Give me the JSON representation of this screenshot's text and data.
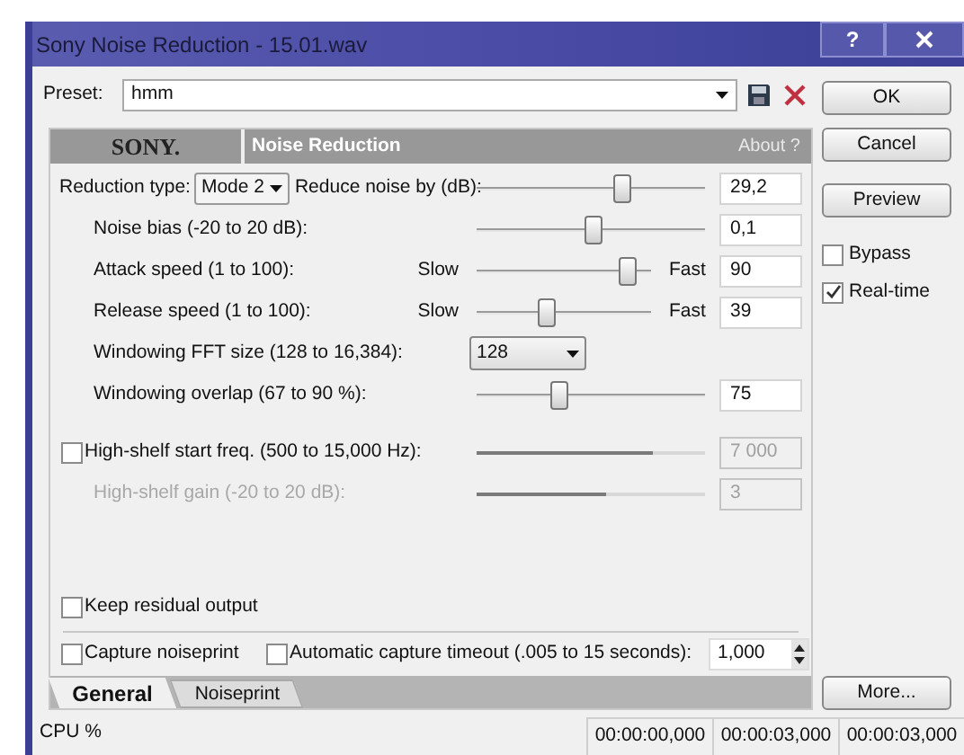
{
  "window": {
    "title": "Sony Noise Reduction - 15.01.wav",
    "help": "?"
  },
  "preset": {
    "label": "Preset:",
    "value": "hmm"
  },
  "header": {
    "logo": "SONY.",
    "title": "Noise Reduction",
    "about": "About ?"
  },
  "rows": [
    {
      "kind": "mode_slider",
      "label": "Reduction type:",
      "mode": "Mode 2",
      "label_2": "Reduce noise by (dB):",
      "level": 0.65,
      "value": "29,2"
    },
    {
      "kind": "slider",
      "label": "Noise bias (-20 to 20 dB):",
      "level": 0.51,
      "value": "0,1",
      "disabled": false
    },
    {
      "kind": "speed_slider",
      "label": "Attack speed (1 to 100):",
      "slow": "Slow",
      "fast": "Fast",
      "level": 0.91,
      "value": "90"
    },
    {
      "kind": "speed_slider",
      "label": "Release speed (1 to 100):",
      "slow": "Slow",
      "fast": "Fast",
      "level": 0.39,
      "value": "39"
    },
    {
      "kind": "dropdown",
      "label": "Windowing FFT size (128 to 16,384):",
      "value": "128"
    },
    {
      "kind": "slider",
      "label": "Windowing overlap (67 to 90 %):",
      "level": 0.35,
      "value": "75",
      "disabled": false
    },
    {
      "kind": "check_slider",
      "label": "High-shelf start freq. (500 to 15,000 Hz):",
      "checked": false,
      "level": 0.77,
      "value": "7 000",
      "disabled": true
    },
    {
      "kind": "slider",
      "label": "High-shelf gain (-20 to 20 dB):",
      "level": 0.57,
      "value": "3",
      "disabled": true
    }
  ],
  "keep_residual": {
    "label": "Keep residual output",
    "checked": false
  },
  "capture": {
    "label": "Capture noiseprint",
    "checked": false
  },
  "auto_timeout": {
    "label": "Automatic capture timeout (.005 to 15 seconds):",
    "checked": false,
    "value": "1,000"
  },
  "tabs": [
    {
      "label": "General",
      "selected": true
    },
    {
      "label": "Noiseprint",
      "selected": false
    }
  ],
  "side_buttons": [
    "OK",
    "Cancel",
    "Preview"
  ],
  "options": [
    {
      "label": "Bypass",
      "checked": false
    },
    {
      "label": "Real-time",
      "checked": true
    }
  ],
  "more_button": "More...",
  "status_bar": {
    "label": "CPU %",
    "times": [
      "00:00:00,000",
      "00:00:03,000",
      "00:00:03,000"
    ]
  }
}
